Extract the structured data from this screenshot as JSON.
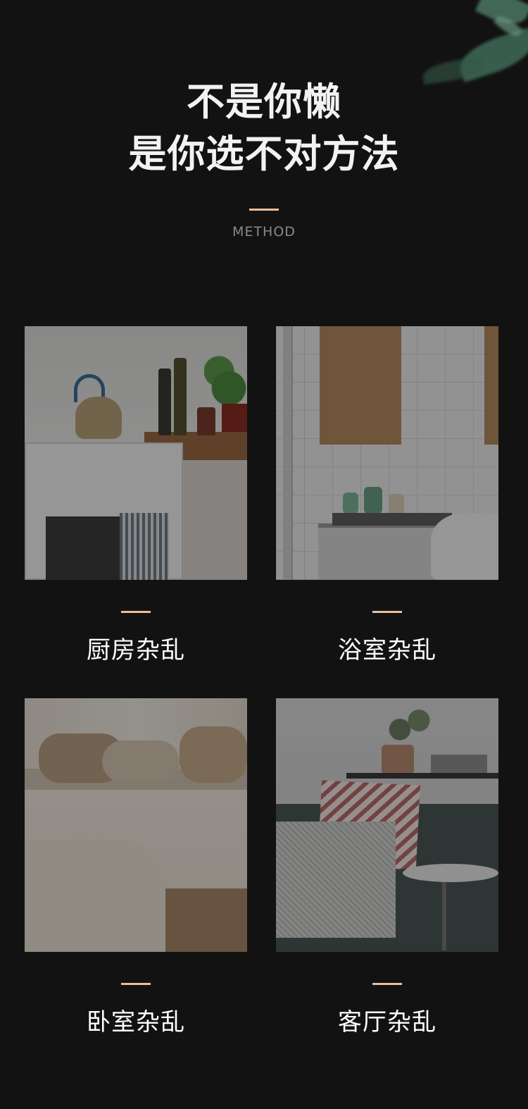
{
  "heading": {
    "line1": "不是你懒",
    "line2": "是你选不对方法"
  },
  "subtitle": "METHOD",
  "colors": {
    "background": "#121212",
    "accent": "#e9bf9d",
    "subtitle": "#8a8a8a"
  },
  "cards": [
    {
      "label": "厨房杂乱",
      "image": "kitchen-photo"
    },
    {
      "label": "浴室杂乱",
      "image": "bathroom-photo"
    },
    {
      "label": "卧室杂乱",
      "image": "bedroom-photo"
    },
    {
      "label": "客厅杂乱",
      "image": "living-room-photo"
    }
  ]
}
